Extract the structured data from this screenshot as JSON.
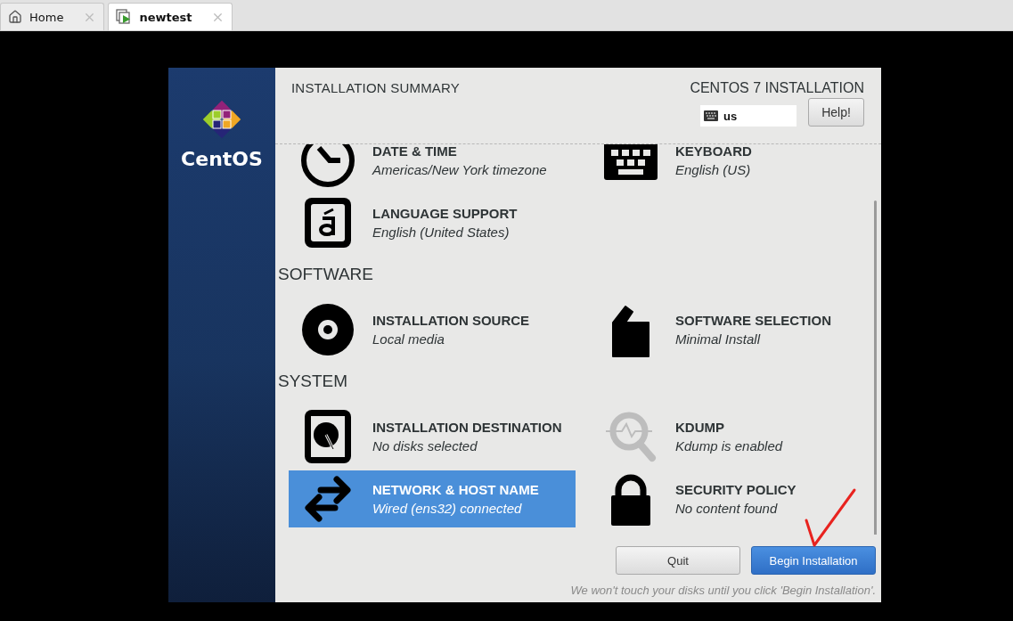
{
  "tabs": [
    {
      "label": "Home",
      "kind": "home",
      "selected": false
    },
    {
      "label": "newtest",
      "kind": "vm",
      "selected": true
    }
  ],
  "sidebar": {
    "logo_text": "CentOS"
  },
  "header": {
    "title": "INSTALLATION SUMMARY",
    "product": "CENTOS 7 INSTALLATION",
    "keyboard_layout": "us",
    "help_button": "Help!"
  },
  "sections": [
    {
      "items": [
        {
          "kind": "clock",
          "title": "DATE & TIME",
          "status": "Americas/New York timezone",
          "selected": false
        },
        {
          "kind": "keyboard",
          "title": "KEYBOARD",
          "status": "English (US)",
          "selected": false
        },
        {
          "kind": "language",
          "title": "LANGUAGE SUPPORT",
          "status": "English (United States)",
          "selected": false
        }
      ]
    },
    {
      "heading": "SOFTWARE",
      "items": [
        {
          "kind": "disc",
          "title": "INSTALLATION SOURCE",
          "status": "Local media",
          "selected": false
        },
        {
          "kind": "package",
          "title": "SOFTWARE SELECTION",
          "status": "Minimal Install",
          "selected": false
        }
      ]
    },
    {
      "heading": "SYSTEM",
      "items": [
        {
          "kind": "disk",
          "title": "INSTALLATION DESTINATION",
          "status": "No disks selected",
          "selected": false
        },
        {
          "kind": "kdump",
          "title": "KDUMP",
          "status": "Kdump is enabled",
          "selected": false
        },
        {
          "kind": "network",
          "title": "NETWORK & HOST NAME",
          "status": "Wired (ens32) connected",
          "selected": true
        },
        {
          "kind": "lock",
          "title": "SECURITY POLICY",
          "status": "No content found",
          "selected": false
        }
      ]
    }
  ],
  "buttons": {
    "quit": "Quit",
    "begin": "Begin Installation"
  },
  "footnote": "We won't touch your disks until you click 'Begin Installation'."
}
